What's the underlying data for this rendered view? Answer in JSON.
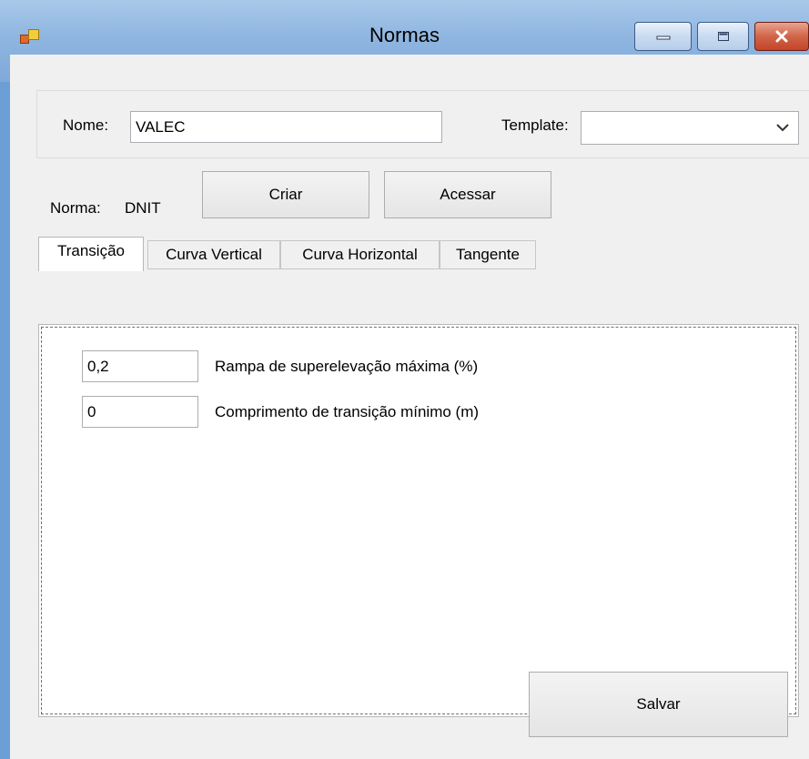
{
  "window": {
    "title": "Normas",
    "minimize_icon": "minimize-icon",
    "maximize_icon": "maximize-icon",
    "close_icon": "close-icon",
    "app_icon": "app-icon"
  },
  "form": {
    "nome_label": "Nome:",
    "nome_value": "VALEC",
    "template_label": "Template:",
    "template_value": "",
    "norma_label": "Norma:",
    "norma_value": "DNIT",
    "criar_label": "Criar",
    "acessar_label": "Acessar",
    "salvar_label": "Salvar"
  },
  "tabs": [
    {
      "label": "Transição",
      "active": true
    },
    {
      "label": "Curva Vertical",
      "active": false
    },
    {
      "label": "Curva Horizontal",
      "active": false
    },
    {
      "label": "Tangente",
      "active": false
    }
  ],
  "transicao": {
    "rampa_value": "0,2",
    "rampa_label": "Rampa de superelevação máxima (%)",
    "comprimento_value": "0",
    "comprimento_label": "Comprimento de transição mínimo (m)"
  },
  "colors": {
    "titlebar": "#8fb6e0",
    "client_bg": "#f0f0f0",
    "close_button": "#c4442a"
  }
}
